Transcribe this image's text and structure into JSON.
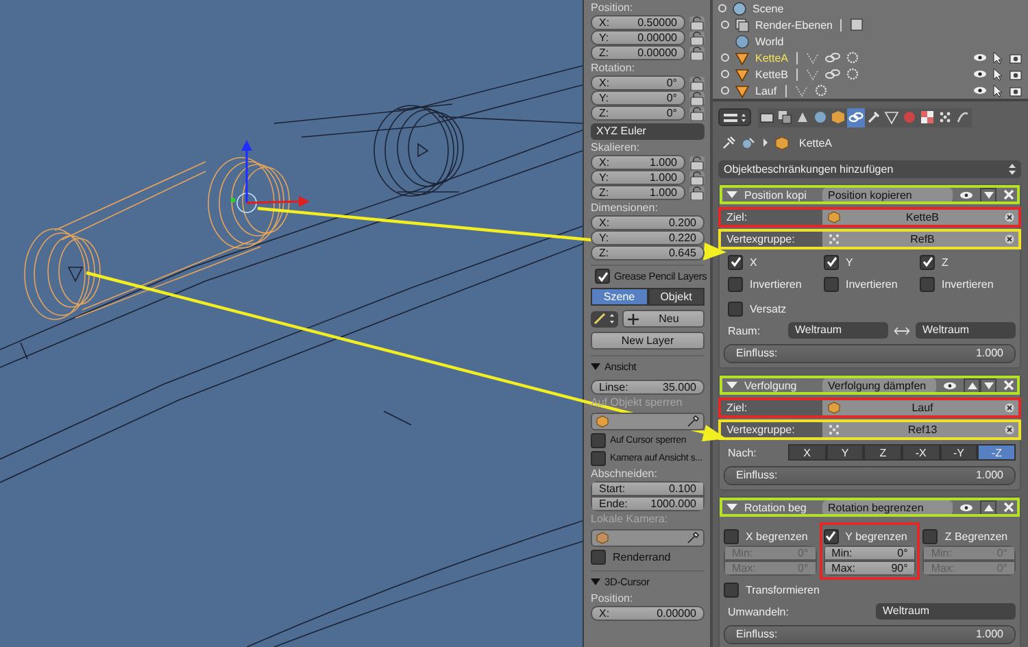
{
  "n_panel": {
    "transform": [
      {
        "label": "Position:",
        "lockable": true,
        "fields": [
          {
            "axis": "X:",
            "value": "0.50000"
          },
          {
            "axis": "Y:",
            "value": "0.00000"
          },
          {
            "axis": "Z:",
            "value": "0.00000"
          }
        ]
      },
      {
        "label": "Rotation:",
        "lockable": true,
        "fields": [
          {
            "axis": "X:",
            "value": "0°"
          },
          {
            "axis": "Y:",
            "value": "0°"
          },
          {
            "axis": "Z:",
            "value": "0°"
          }
        ],
        "mode": "XYZ Euler"
      },
      {
        "label": "Skalieren:",
        "lockable": true,
        "fields": [
          {
            "axis": "X:",
            "value": "1.000"
          },
          {
            "axis": "Y:",
            "value": "1.000"
          },
          {
            "axis": "Z:",
            "value": "1.000"
          }
        ]
      },
      {
        "label": "Dimensionen:",
        "lockable": false,
        "fields": [
          {
            "axis": "X:",
            "value": "0.200"
          },
          {
            "axis": "Y:",
            "value": "0.220"
          },
          {
            "axis": "Z:",
            "value": "0.645"
          }
        ]
      }
    ],
    "grease_pencil": {
      "title": "Grease Pencil Layers",
      "enabled": true,
      "tabs": [
        {
          "label": "Szene",
          "selected": true
        },
        {
          "label": "Objekt",
          "selected": false
        }
      ],
      "new_button": "Neu",
      "new_layer_button": "New Layer"
    },
    "view": {
      "title": "Ansicht",
      "lens": {
        "label": "Linse:",
        "value": "35.000"
      },
      "lock_object_label": "Auf Objekt sperren",
      "options": [
        {
          "label": "Auf Cursor sperren",
          "checked": false
        },
        {
          "label": "Kamera auf Ansicht s...",
          "checked": false
        }
      ],
      "clip_label": "Abschneiden:",
      "clip": [
        {
          "label": "Start:",
          "value": "0.100"
        },
        {
          "label": "Ende:",
          "value": "1000.000"
        }
      ],
      "local_camera_label": "Lokale Kamera:",
      "render_border": {
        "label": "Renderrand",
        "checked": false
      }
    },
    "cursor": {
      "title": "3D-Cursor",
      "position_label": "Position:",
      "fields": [
        {
          "axis": "X:",
          "value": "0.00000"
        }
      ]
    }
  },
  "outliner": {
    "items": [
      {
        "kind": "scene",
        "label": "Scene",
        "selected": false,
        "children": [
          {
            "kind": "render_layers",
            "label": "Render-Ebenen",
            "selected": false
          },
          {
            "kind": "world",
            "label": "World",
            "selected": false
          },
          {
            "kind": "object",
            "label": "KetteA",
            "selected": true,
            "has_constraints": true
          },
          {
            "kind": "object",
            "label": "KetteB",
            "selected": false,
            "has_constraints": true
          },
          {
            "kind": "object",
            "label": "Lauf",
            "selected": false,
            "has_constraints": false
          }
        ]
      }
    ]
  },
  "properties": {
    "tabs": [
      {
        "kind": "render",
        "selected": false
      },
      {
        "kind": "layers",
        "selected": false
      },
      {
        "kind": "scene",
        "selected": false
      },
      {
        "kind": "world",
        "selected": false
      },
      {
        "kind": "object",
        "selected": false
      },
      {
        "kind": "constraints",
        "selected": true
      },
      {
        "kind": "modifiers",
        "selected": false
      },
      {
        "kind": "data",
        "selected": false
      },
      {
        "kind": "material",
        "selected": false
      },
      {
        "kind": "texture",
        "selected": false
      },
      {
        "kind": "particles",
        "selected": false
      },
      {
        "kind": "physics",
        "selected": false
      }
    ],
    "object_name": "KetteA",
    "add_constraint": "Objektbeschränkungen hinzufügen",
    "constraints": [
      {
        "kind": "copy_location",
        "name": "Position kopi",
        "type": "Position kopieren",
        "move_up": false,
        "move_down": true,
        "target": {
          "label": "Ziel:",
          "value": "KetteB"
        },
        "vertex_group": {
          "label": "Vertexgruppe:",
          "value": "RefB"
        },
        "axes": [
          {
            "label": "X",
            "checked": true
          },
          {
            "label": "Y",
            "checked": true
          },
          {
            "label": "Z",
            "checked": true
          }
        ],
        "invert": [
          {
            "label": "Invertieren",
            "checked": false
          },
          {
            "label": "Invertieren",
            "checked": false
          },
          {
            "label": "Invertieren",
            "checked": false
          }
        ],
        "offset": {
          "label": "Versatz",
          "checked": false
        },
        "space": {
          "label": "Raum:",
          "from": "Weltraum",
          "to": "Weltraum"
        },
        "influence": {
          "label": "Einfluss:",
          "value": "1.000",
          "level": 1
        }
      },
      {
        "kind": "damped_track",
        "name": "Verfolgung",
        "type": "Verfolgung dämpfen",
        "move_up": true,
        "move_down": true,
        "target": {
          "label": "Ziel:",
          "value": "Lauf"
        },
        "vertex_group": {
          "label": "Vertexgruppe:",
          "value": "Ref13"
        },
        "track": {
          "label": "Nach:",
          "options": [
            {
              "label": "X",
              "selected": false
            },
            {
              "label": "Y",
              "selected": false
            },
            {
              "label": "Z",
              "selected": false
            },
            {
              "label": "-X",
              "selected": false
            },
            {
              "label": "-Y",
              "selected": false
            },
            {
              "label": "-Z",
              "selected": true
            }
          ]
        },
        "influence": {
          "label": "Einfluss:",
          "value": "1.000",
          "level": 1
        }
      },
      {
        "kind": "limit_rotation",
        "name": "Rotation beg",
        "type": "Rotation begrenzen",
        "move_up": true,
        "move_down": false,
        "limits": [
          {
            "label": "X begrenzen",
            "checked": false,
            "min": {
              "label": "Min:",
              "value": "0°"
            },
            "max": {
              "label": "Max:",
              "value": "0°"
            }
          },
          {
            "label": "Y begrenzen",
            "checked": true,
            "min": {
              "label": "Min:",
              "value": "0°"
            },
            "max": {
              "label": "Max:",
              "value": "90°"
            }
          },
          {
            "label": "Z Begrenzen",
            "checked": false,
            "min": {
              "label": "Min:",
              "value": "0°"
            },
            "max": {
              "label": "Max:",
              "value": "0°"
            }
          }
        ],
        "transform": {
          "label": "Transformieren",
          "checked": false
        },
        "convert": {
          "label": "Umwandeln:",
          "value": "Weltraum"
        },
        "influence": {
          "label": "Einfluss:",
          "value": "1.000",
          "level": 1
        }
      }
    ]
  }
}
